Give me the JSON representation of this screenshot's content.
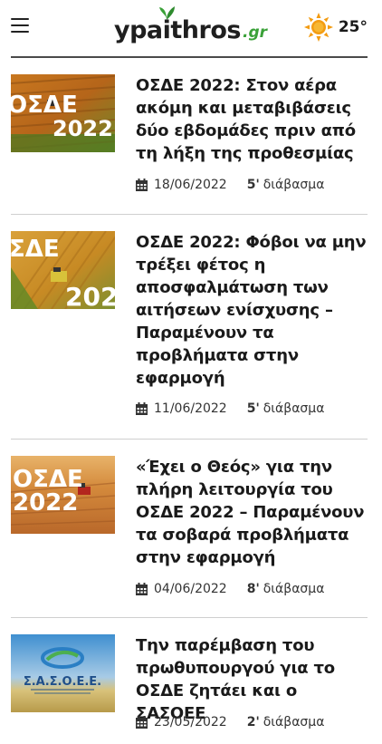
{
  "header": {
    "logo_main": "ypaithros",
    "logo_suffix": ".gr",
    "temperature": "25°",
    "weather_icon": "sun-icon",
    "menu_icon": "hamburger-menu-icon",
    "brand_green": "#3aa138",
    "sun_color": "#f39c12"
  },
  "articles": [
    {
      "title": "ΟΣΔΕ 2022: Στον αέρα ακόμη και μεταβιβάσεις δύο εβδομάδες πριν από τη λήξη της προθεσμίας",
      "date": "18/06/2022",
      "read_minutes": "5'",
      "read_label": "διάβασμα",
      "thumb_text_top": "ΟΣΔΕ",
      "thumb_text_bottom": "2022"
    },
    {
      "title": "ΟΣΔΕ 2022: Φόβοι να μην τρέξει φέτος η αποσφαλμάτωση των αιτήσεων ενίσχυσης – Παραμένουν τα προβλήματα στην εφαρμογή",
      "date": "11/06/2022",
      "read_minutes": "5'",
      "read_label": "διάβασμα",
      "thumb_text_top": "ΣΔΕ",
      "thumb_text_bottom": "202"
    },
    {
      "title": "«Έχει ο Θεός» για την πλήρη λειτουργία του ΟΣΔΕ 2022 – Παραμένουν τα σοβαρά προβλήματα στην εφαρμογή",
      "date": "04/06/2022",
      "read_minutes": "8'",
      "read_label": "διάβασμα",
      "thumb_text_top": "ΟΣΔΕ",
      "thumb_text_bottom": "2022"
    },
    {
      "title": "Την παρέμβαση του πρωθυπουργού για το ΟΣΔΕ ζητάει και ο ΣΑΣΟΕΕ",
      "date": "23/05/2022",
      "read_minutes": "2'",
      "read_label": "διάβασμα",
      "thumb_text_top": "Σ.Α.Σ.Ο.Ε.Ε.",
      "thumb_text_bottom": ""
    }
  ]
}
